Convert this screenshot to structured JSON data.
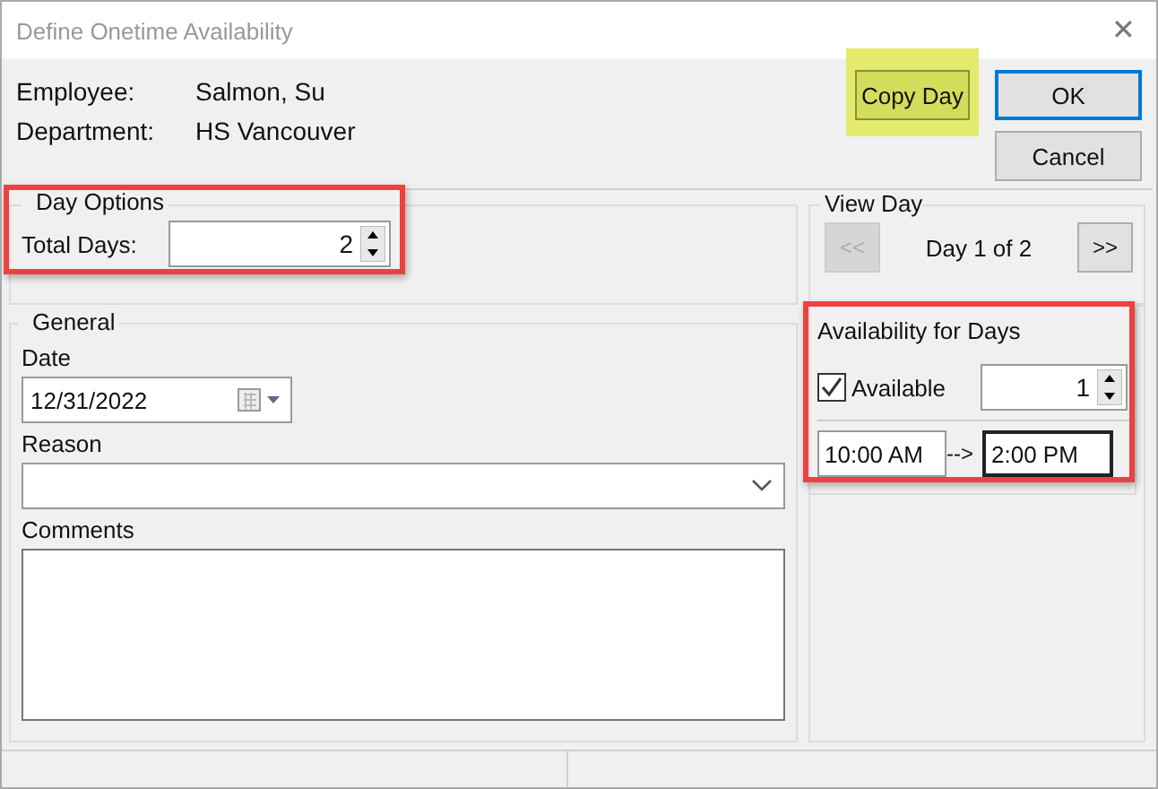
{
  "window": {
    "title": "Define Onetime Availability",
    "close": "✕"
  },
  "header": {
    "fields": [
      {
        "label": "Employee:",
        "value": "Salmon, Su"
      },
      {
        "label": "Department:",
        "value": "HS Vancouver"
      }
    ],
    "buttons": [
      {
        "label": "Copy Day",
        "kind": "copy",
        "highlighted": true,
        "default": false
      },
      {
        "label": "OK",
        "kind": "ok",
        "default": true
      },
      {
        "label": "Cancel",
        "kind": "cancel",
        "default": false
      }
    ]
  },
  "day_options": {
    "title": "Day Options",
    "highlighted": true,
    "total_days_label": "Total Days:",
    "total_days": "2"
  },
  "general": {
    "title": "General",
    "date_label": "Date",
    "date": "12/31/2022",
    "reason_label": "Reason",
    "comments_label": "Comments"
  },
  "view_day": {
    "title": "View Day",
    "prev": {
      "label": "<<",
      "disabled": true
    },
    "day": "Day 1 of 2",
    "next": {
      "label": ">>",
      "disabled": false
    }
  },
  "availability": {
    "title": "Availability for Days",
    "highlighted": true,
    "available_label": "Available",
    "checked": true,
    "count": "1",
    "start": "10:00 AM",
    "arrow": "-->",
    "end": "2:00 PM"
  }
}
